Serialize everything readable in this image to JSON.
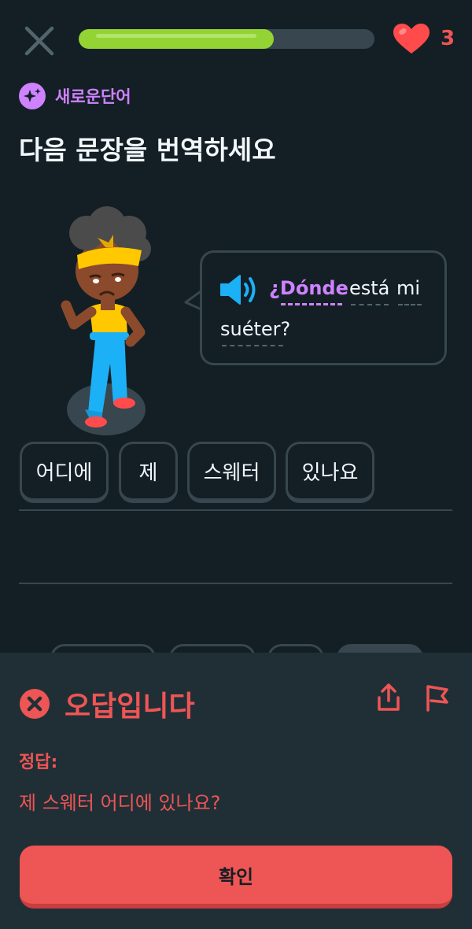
{
  "top_bar": {
    "progress_fraction": 0.66,
    "hearts": "3",
    "colors": {
      "progress": "#93d333",
      "hearts": "#ee5555"
    },
    "icons": [
      "close-icon",
      "heart-icon"
    ]
  },
  "header": {
    "badge_label": "새로운단어",
    "badge_color": "#ce82ff",
    "title": "다음 문장을 번역하세요"
  },
  "prompt": {
    "words": [
      "¿Dónde",
      "está",
      "mi",
      "suéter?"
    ],
    "new_word": "¿Dónde",
    "icon": "speaker-icon"
  },
  "answer_chips": [
    "어디에",
    "제",
    "스웨터",
    "있나요"
  ],
  "feedback": {
    "status": "오답입니다",
    "correct_label": "정답:",
    "correct_answer": "제 스웨터 어디에 있나요?",
    "button": "확인",
    "color": "#ee5555",
    "icons": [
      "error-x-icon",
      "share-icon",
      "flag-icon"
    ]
  }
}
